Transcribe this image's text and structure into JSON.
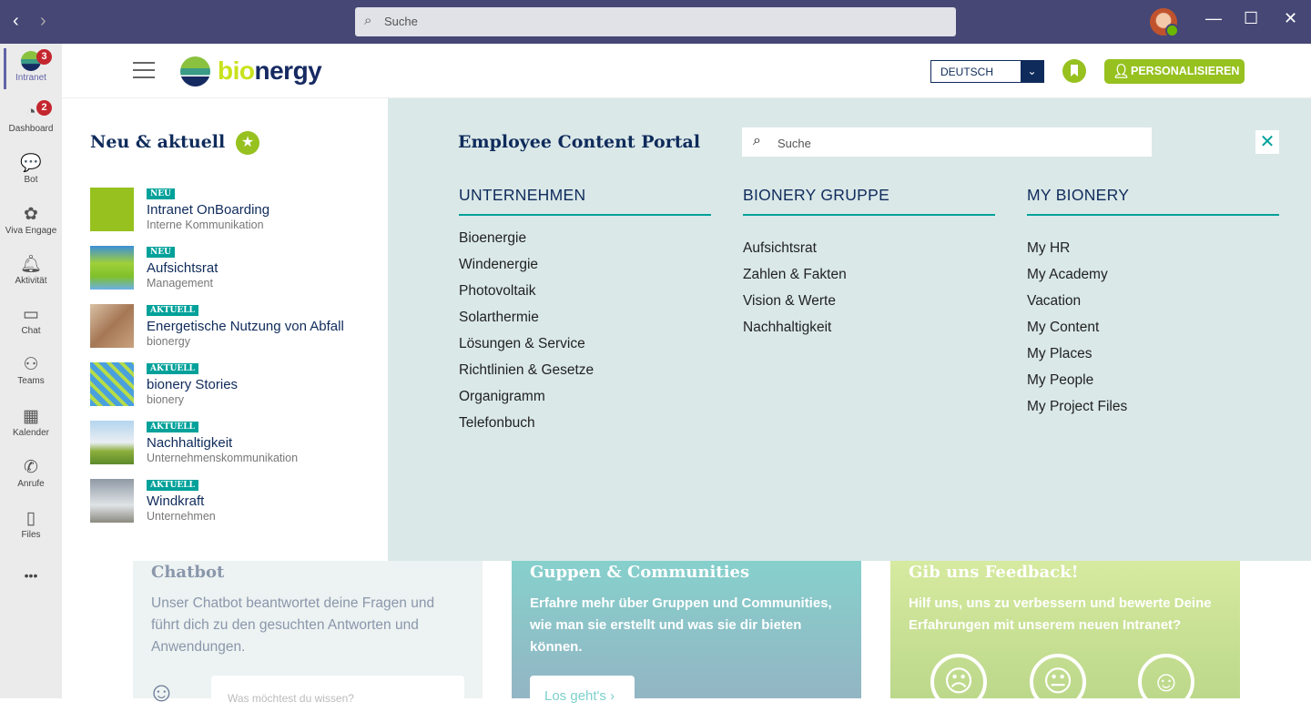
{
  "titlebar": {
    "search_placeholder": "Suche"
  },
  "rail": {
    "items": [
      {
        "label": "Intranet",
        "badge": "3",
        "icon": "bionergy-logo-icon"
      },
      {
        "label": "Dashboard",
        "badge": "2",
        "icon": "gauge-icon"
      },
      {
        "label": "Bot",
        "icon": "bot-icon"
      },
      {
        "label": "Viva Engage",
        "icon": "viva-engage-icon"
      },
      {
        "label": "Aktivität",
        "icon": "bell-icon"
      },
      {
        "label": "Chat",
        "icon": "chat-icon"
      },
      {
        "label": "Teams",
        "icon": "teams-icon"
      },
      {
        "label": "Kalender",
        "icon": "calendar-icon"
      },
      {
        "label": "Anrufe",
        "icon": "phone-icon"
      },
      {
        "label": "Files",
        "icon": "file-icon"
      }
    ],
    "more": "•••"
  },
  "header": {
    "logo": "bionergy",
    "language": "DEUTSCH",
    "personalize": "PERSONALISIEREN"
  },
  "news": {
    "title": "Neu & aktuell",
    "items": [
      {
        "tag": "NEU",
        "title": "Intranet OnBoarding",
        "sub": "Interne Kommunikation"
      },
      {
        "tag": "NEU",
        "title": "Aufsichtsrat",
        "sub": "Management"
      },
      {
        "tag": "AKTUELL",
        "title": "Energetische Nutzung von Abfall",
        "sub": "bionergy"
      },
      {
        "tag": "AKTUELL",
        "title": "bionery Stories",
        "sub": "bionery"
      },
      {
        "tag": "AKTUELL",
        "title": "Nachhaltigkeit",
        "sub": "Unternehmenskommunikation"
      },
      {
        "tag": "AKTUELL",
        "title": "Windkraft",
        "sub": "Unternehmen"
      }
    ]
  },
  "portal": {
    "title": "Employee Content Portal",
    "search_placeholder": "Suche",
    "columns": [
      {
        "heading": "UNTERNEHMEN",
        "links": [
          "Bioenergie",
          "Windenergie",
          "Photovoltaik",
          "Solarthermie",
          "Lösungen & Service",
          "Richtlinien & Gesetze",
          "Organigramm",
          "Telefonbuch"
        ]
      },
      {
        "heading": "BIONERY GRUPPE",
        "links": [
          "Aufsichtsrat",
          "Zahlen & Fakten",
          "Vision & Werte",
          "Nachhaltigkeit"
        ]
      },
      {
        "heading": "MY BIONERY",
        "links": [
          "My HR",
          "My Academy",
          "Vacation",
          "My Content",
          "My Places",
          "My People",
          "My Project Files"
        ]
      }
    ]
  },
  "cards": {
    "chatbot": {
      "title": "Chatbot",
      "text": "Unser Chatbot beantwortet deine Fragen und führt dich zu den gesuchten Antworten und Anwendungen.",
      "placeholder": "Was möchtest du wissen?"
    },
    "communities": {
      "title": "Guppen & Communities",
      "text": "Erfahre mehr über Gruppen und Communities, wie man sie erstellt und was sie dir bieten können.",
      "button": "Los geht's"
    },
    "feedback": {
      "title": "Gib uns Feedback!",
      "text": "Hilf uns, uns zu verbessern und bewerte Deine Erfahrungen mit unserem neuen Intranet?"
    }
  },
  "colors": {
    "titlebar": "#464775",
    "navy": "#0f2b5b",
    "green": "#96c11f",
    "teal": "#00a19a",
    "portal_bg": "#dae8e8"
  }
}
